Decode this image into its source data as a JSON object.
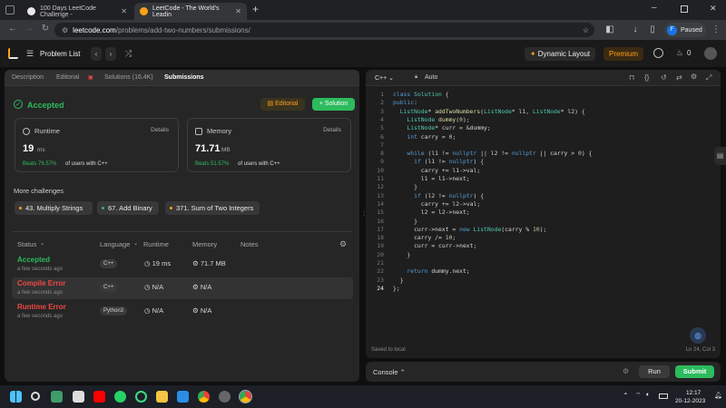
{
  "browser": {
    "tabs": [
      {
        "title": "100 Days LeetCode Challenge -",
        "active": false
      },
      {
        "title": "LeetCode - The World's Leadin",
        "active": true
      }
    ],
    "new_tab": "+",
    "url_host": "leetcode.com",
    "url_path": "/problems/add-two-numbers/submissions/",
    "profile_initial": "F",
    "profile_status": "Paused"
  },
  "header": {
    "problem_list": "Problem List",
    "dynamic_layout": "Dynamic Layout",
    "premium": "Premium",
    "streak": "0"
  },
  "left_tabs": [
    "Description",
    "Editorial",
    "Solutions (16.4K)",
    "Submissions"
  ],
  "result": {
    "status": "Accepted",
    "editorial_button": "Editorial",
    "solution_button": "+ Solution",
    "runtime": {
      "label": "Runtime",
      "details": "Details",
      "value": "19",
      "unit": "ms",
      "beats_prefix": "Beats",
      "beats": "76.57%",
      "beats_suffix": "of users with C++"
    },
    "memory": {
      "label": "Memory",
      "details": "Details",
      "value": "71.71",
      "unit": "MB",
      "beats_prefix": "Beats",
      "beats": "51.57%",
      "beats_suffix": "of users with C++"
    }
  },
  "more_challenges": {
    "title": "More challenges",
    "items": [
      "43. Multiply Strings",
      "67. Add Binary",
      "371. Sum of Two Integers"
    ]
  },
  "table": {
    "headers": [
      "Status",
      "Language",
      "Runtime",
      "Memory",
      "Notes"
    ],
    "rows": [
      {
        "status": "Accepted",
        "time": "a few seconds ago",
        "language": "C++",
        "runtime": "19 ms",
        "memory": "71.7 MB",
        "color": "#2cbb5d"
      },
      {
        "status": "Compile Error",
        "time": "a few seconds ago",
        "language": "C++",
        "runtime": "N/A",
        "memory": "N/A",
        "color": "#ef4743"
      },
      {
        "status": "Runtime Error",
        "time": "a few seconds ago",
        "language": "Python3",
        "runtime": "N/A",
        "memory": "N/A",
        "color": "#ef4743"
      }
    ]
  },
  "editor": {
    "language": "C++",
    "auto": "Auto",
    "saved": "Saved to local",
    "cursor": "Ln 24, Col 3",
    "line_numbers": [
      "1",
      "2",
      "3",
      "4",
      "5",
      "6",
      "7",
      "8",
      "9",
      "10",
      "11",
      "12",
      "13",
      "14",
      "15",
      "16",
      "17",
      "18",
      "19",
      "20",
      "21",
      "22",
      "23",
      "24"
    ],
    "lines": [
      "class Solution {",
      "public:",
      "  ListNode* addTwoNumbers(ListNode* l1, ListNode* l2) {",
      "    ListNode dummy(0);",
      "    ListNode* curr = &dummy;",
      "    int carry = 0;",
      "",
      "    while (l1 != nullptr || l2 != nullptr || carry > 0) {",
      "      if (l1 != nullptr) {",
      "        carry += l1->val;",
      "        l1 = l1->next;",
      "      }",
      "      if (l2 != nullptr) {",
      "        carry += l2->val;",
      "        l2 = l2->next;",
      "      }",
      "      curr->next = new ListNode(carry % 10);",
      "      carry /= 10;",
      "      curr = curr->next;",
      "    }",
      "",
      "    return dummy.next;",
      "  }",
      "};"
    ]
  },
  "console": {
    "label": "Console",
    "run": "Run",
    "submit": "Submit"
  },
  "taskbar": {
    "time": "12:17",
    "date": "20-12-2023",
    "lang": "ENG\nIN"
  },
  "colors": {
    "accent_green": "#2cbb5d",
    "error_red": "#ef4743",
    "premium_orange": "#ffa116"
  }
}
